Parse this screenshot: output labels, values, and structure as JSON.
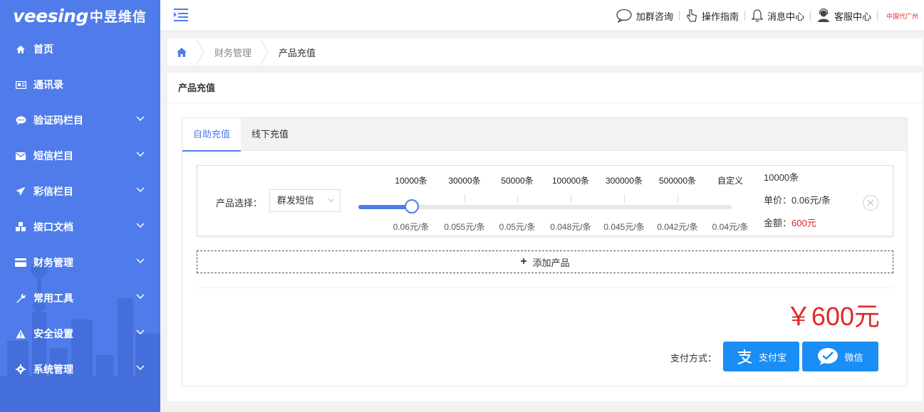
{
  "brand": {
    "logo_en": "veesing",
    "logo_cn": "中昱维信",
    "partner_mark": "中国代广州"
  },
  "topbar": {
    "links": [
      {
        "label": "加群咨询",
        "icon": "chat-bubble-icon"
      },
      {
        "label": "操作指南",
        "icon": "hand-pointer-icon"
      },
      {
        "label": "消息中心",
        "icon": "bell-icon"
      },
      {
        "label": "客服中心",
        "icon": "support-agent-icon"
      }
    ]
  },
  "sidebar": {
    "items": [
      {
        "label": "首页",
        "icon": "home-icon",
        "has_children": false
      },
      {
        "label": "通讯录",
        "icon": "address-card-icon",
        "has_children": false
      },
      {
        "label": "验证码栏目",
        "icon": "comment-icon",
        "has_children": true
      },
      {
        "label": "短信栏目",
        "icon": "envelope-icon",
        "has_children": true
      },
      {
        "label": "彩信栏目",
        "icon": "paper-plane-icon",
        "has_children": true
      },
      {
        "label": "接口文档",
        "icon": "cubes-icon",
        "has_children": true
      },
      {
        "label": "财务管理",
        "icon": "credit-card-icon",
        "has_children": true
      },
      {
        "label": "常用工具",
        "icon": "wrench-icon",
        "has_children": true
      },
      {
        "label": "安全设置",
        "icon": "warning-icon",
        "has_children": true
      },
      {
        "label": "系统管理",
        "icon": "cog-icon",
        "has_children": true
      }
    ]
  },
  "breadcrumb": {
    "parent": "财务管理",
    "current": "产品充值"
  },
  "panel": {
    "title": "产品充值",
    "tabs": [
      {
        "label": "自助充值",
        "active": true
      },
      {
        "label": "线下充值",
        "active": false
      }
    ]
  },
  "product": {
    "label": "产品选择：",
    "selected": "群发短信",
    "tiers": [
      {
        "qty": "10000条",
        "price": "0.06元/条"
      },
      {
        "qty": "30000条",
        "price": "0.055元/条"
      },
      {
        "qty": "50000条",
        "price": "0.05元/条"
      },
      {
        "qty": "100000条",
        "price": "0.048元/条"
      },
      {
        "qty": "300000条",
        "price": "0.045元/条"
      },
      {
        "qty": "500000条",
        "price": "0.042元/条"
      },
      {
        "qty": "自定义",
        "price": "0.04元/条"
      }
    ],
    "slider_fraction": 0.143,
    "summary_qty": "10000条",
    "unit_price_label": "单价：",
    "unit_price": "0.06元/条",
    "amount_label": "金额：",
    "amount": "600元"
  },
  "add_product_label": "添加产品",
  "total": "￥600元",
  "payment": {
    "label": "支付方式：",
    "alipay": "支付宝",
    "wechat": "微信"
  },
  "colors": {
    "accent": "#4f7cea",
    "pay_blue": "#1a8ef5",
    "price_red": "#e02828"
  }
}
